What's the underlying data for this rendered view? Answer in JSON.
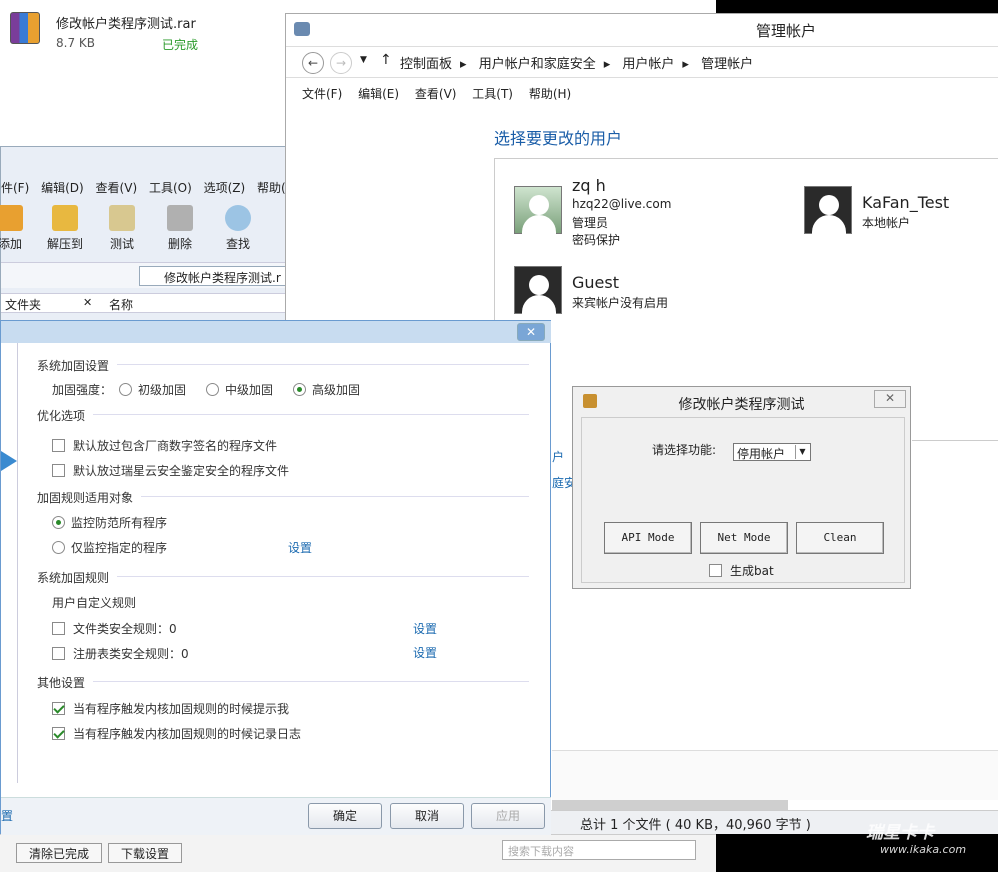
{
  "download": {
    "filename": "修改帐户类程序测试.rar",
    "size": "8.7 KB",
    "status": "已完成",
    "clear_label": "清除已完成",
    "settings_label": "下载设置",
    "search_placeholder": "搜索下载内容"
  },
  "winrar": {
    "menu": [
      "件(F)",
      "编辑(D)",
      "查看(V)",
      "工具(O)",
      "选项(Z)",
      "帮助(H)"
    ],
    "toolbar": [
      "添加",
      "解压到",
      "测试",
      "删除",
      "查找"
    ],
    "path": "修改帐户类程序测试.r",
    "col_folder": "文件夹",
    "col_name": "名称"
  },
  "manage": {
    "title": "管理帐户",
    "breadcrumb": [
      "控制面板",
      "用户帐户和家庭安全",
      "用户帐户",
      "管理帐户"
    ],
    "menu": [
      "文件(F)",
      "编辑(E)",
      "查看(V)",
      "工具(T)",
      "帮助(H)"
    ],
    "heading": "选择要更改的用户",
    "users": [
      {
        "name": "zq h",
        "lines": [
          "hzq22@live.com",
          "管理员",
          "密码保护"
        ]
      },
      {
        "name": "KaFan_Test",
        "lines": [
          "本地帐户"
        ]
      },
      {
        "name": "Guest",
        "lines": [
          "来宾帐户没有启用"
        ]
      }
    ],
    "side_links": [
      "户",
      "庭安"
    ],
    "status": "总计 1 个文件 ( 40 KB，40,960 字节 )"
  },
  "tool": {
    "title": "修改帐户类程序测试",
    "close": "✕",
    "label": "请选择功能:",
    "selected": "停用帐户",
    "buttons": [
      "API Mode",
      "Net Mode",
      "Clean"
    ],
    "checkbox": "生成bat"
  },
  "security": {
    "close": "✕",
    "s1": "系统加固设置",
    "strength_label": "加固强度：",
    "strength_options": [
      "初级加固",
      "中级加固",
      "高级加固"
    ],
    "s2": "优化选项",
    "opt1": "默认放过包含厂商数字签名的程序文件",
    "opt2": "默认放过瑞星云安全鉴定安全的程序文件",
    "s3": "加固规则适用对象",
    "target1": "监控防范所有程序",
    "target2": "仅监控指定的程序",
    "setting": "设置",
    "s4": "系统加固规则",
    "custom": "用户自定义规则",
    "rule1": "文件类安全规则：0",
    "rule2": "注册表类安全规则：0",
    "s5": "其他设置",
    "other1": "当有程序触发内核加固规则的时候提示我",
    "other2": "当有程序触发内核加固规则的时候记录日志",
    "left_text": "置",
    "ok": "确定",
    "cancel": "取消",
    "apply": "应用"
  },
  "watermark": {
    "brand": "瑞星卡卡",
    "url": "www.ikaka.com"
  }
}
